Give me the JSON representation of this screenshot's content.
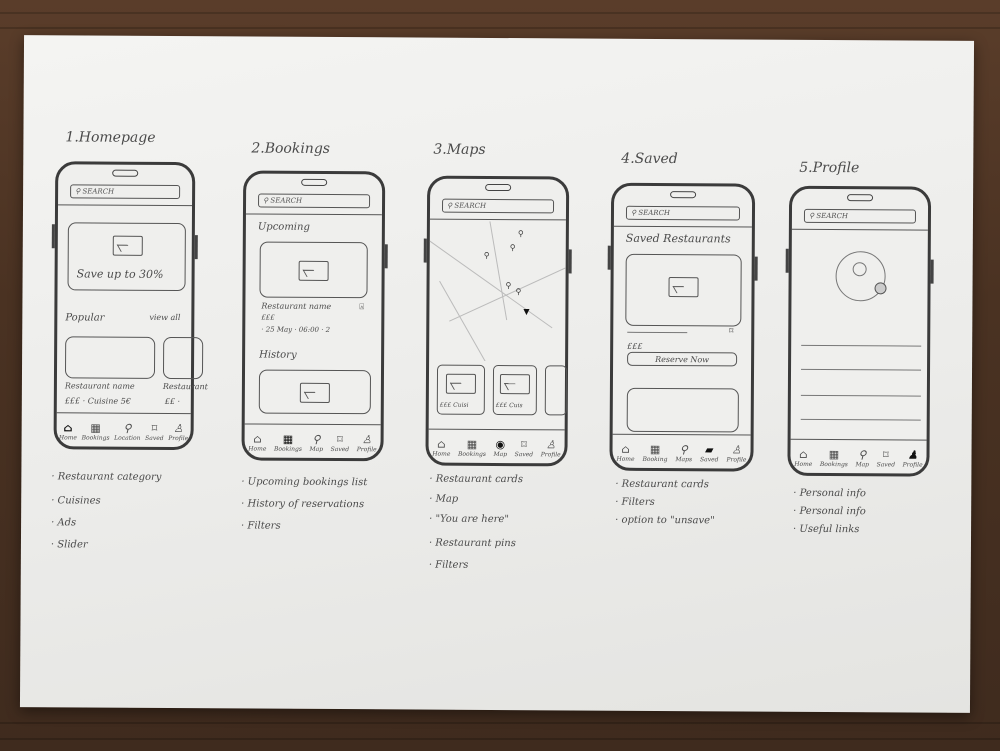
{
  "screens": [
    {
      "title": "1.Homepage",
      "search": "search",
      "banner": "Save up to 30%",
      "popular": "Popular",
      "view_all": "view all",
      "card1_name": "Restaurant name",
      "card1_meta": "£££   · Cuisine  5€",
      "card2_name": "Restaurant",
      "card2_meta": "££ ·",
      "tabs": [
        "Home",
        "Bookings",
        "Location",
        "Saved",
        "Profile"
      ],
      "notes": [
        "· Restaurant category",
        "· Cuisines",
        "· Ads",
        "· Slider"
      ]
    },
    {
      "title": "2.Bookings",
      "search": "search",
      "upcoming": "Upcoming",
      "restaurant_name": "Restaurant name",
      "price": "£££",
      "details": "· 25 May   · 06:00   · 2",
      "history": "History",
      "tabs": [
        "Home",
        "Bookings",
        "Map",
        "Saved",
        "Profile"
      ],
      "notes": [
        "· Upcoming bookings list",
        "· History of reservations",
        "· Filters"
      ]
    },
    {
      "title": "3.Maps",
      "search": "search",
      "card1_meta": "£££  Cuisi",
      "card2_meta": "£££  Cuis",
      "tabs": [
        "Home",
        "Bookings",
        "Map",
        "Saved",
        "Profile"
      ],
      "notes": [
        "· Restaurant cards",
        "· Map",
        "· \"You are here\"",
        "· Restaurant pins",
        "· Filters"
      ]
    },
    {
      "title": "4.Saved",
      "search": "search",
      "heading": "Saved Restaurants",
      "price": "£££",
      "reserve": "Reserve Now",
      "tabs": [
        "Home",
        "Booking",
        "Maps",
        "Saved",
        "Profile"
      ],
      "notes": [
        "· Restaurant cards",
        "· Filters",
        "· option to \"unsave\""
      ]
    },
    {
      "title": "5.Profile",
      "search": "search",
      "tabs": [
        "Home",
        "Bookings",
        "Map",
        "Saved",
        "Profile"
      ],
      "notes": [
        "· Personal info",
        "· Personal info",
        "· Useful links"
      ]
    }
  ],
  "icons": {
    "home": "home-icon",
    "bookings": "calendar-icon",
    "location": "pin-icon",
    "saved": "bookmark-icon",
    "profile": "person-icon"
  }
}
